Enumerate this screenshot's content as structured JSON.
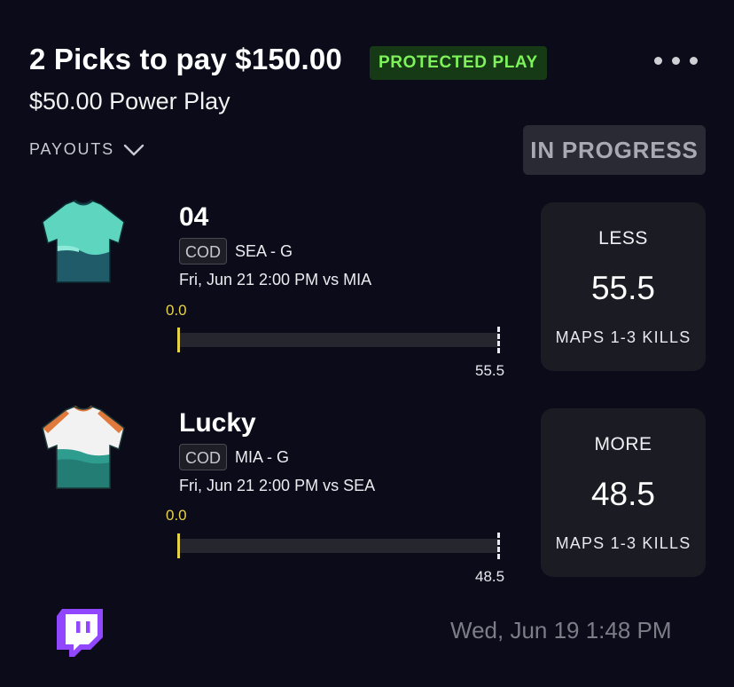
{
  "header": {
    "title": "2 Picks to pay $150.00",
    "badge": "PROTECTED PLAY",
    "subtitle": "$50.00 Power Play",
    "payouts_label": "PAYOUTS",
    "status": "IN PROGRESS",
    "more_icon": "more-horizontal-icon"
  },
  "colors": {
    "background": "#0c0b1a",
    "badge_bg": "#163a16",
    "badge_text": "#7ef25a",
    "progress_marker": "#e6d34a",
    "card_bg": "#1b1b24"
  },
  "picks": [
    {
      "player": "04",
      "league": "COD",
      "team_pos": "SEA - G",
      "game_time": "Fri, Jun 21 2:00 PM  vs MIA",
      "current": "0.0",
      "target": "55.5",
      "progress": 0.0,
      "direction": "LESS",
      "line": "55.5",
      "stat": "MAPS 1-3 KILLS",
      "jersey_icon": "teal-jersey-icon"
    },
    {
      "player": "Lucky",
      "league": "COD",
      "team_pos": "MIA - G",
      "game_time": "Fri, Jun 21 2:00 PM  vs SEA",
      "current": "0.0",
      "target": "48.5",
      "progress": 0.0,
      "direction": "MORE",
      "line": "48.5",
      "stat": "MAPS 1-3 KILLS",
      "jersey_icon": "white-teal-jersey-icon"
    }
  ],
  "footer": {
    "stream_icon": "twitch-icon",
    "timestamp": "Wed, Jun 19 1:48 PM"
  }
}
